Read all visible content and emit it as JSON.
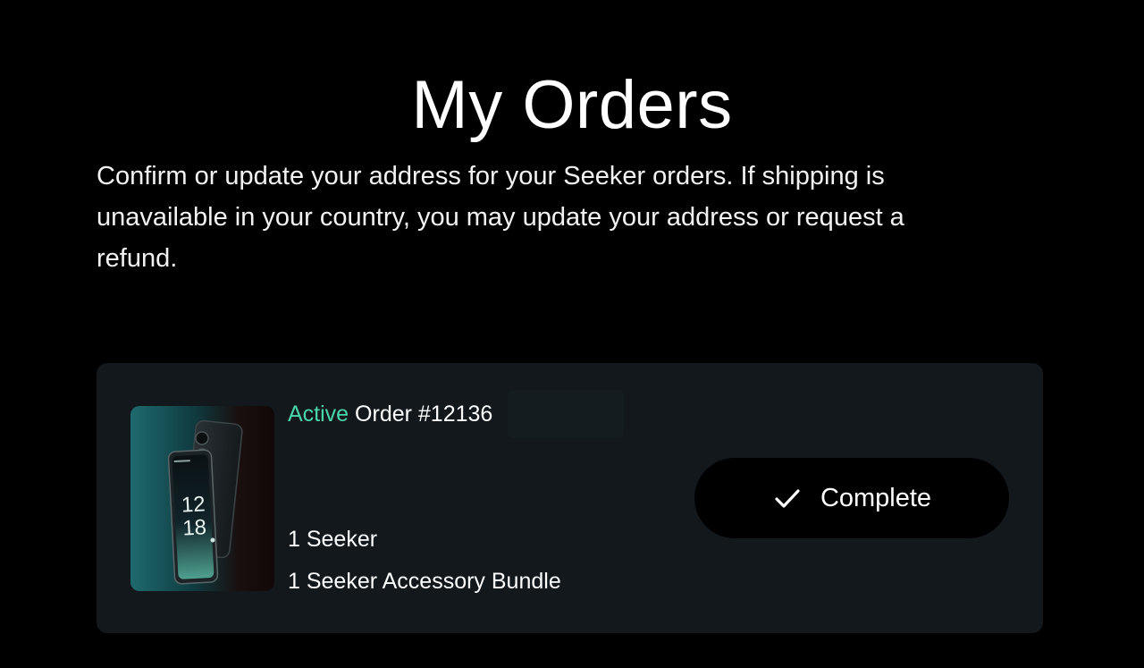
{
  "page": {
    "title": "My Orders",
    "intro": "Confirm or update your address for your Seeker orders. If shipping is unavailable in your country, you may update your address or request a refund."
  },
  "order": {
    "status": "Active",
    "number_label": "Order #12136",
    "items": [
      "1 Seeker",
      "1 Seeker Accessory Bundle"
    ],
    "action": {
      "label": "Complete",
      "icon": "check-icon"
    },
    "thumbnail": {
      "clock_hour": "12",
      "clock_minute": "18"
    }
  },
  "colors": {
    "background": "#000000",
    "card": "#12181c",
    "status_active": "#49d6a8",
    "button_bg": "#000000",
    "text": "#ffffff"
  }
}
